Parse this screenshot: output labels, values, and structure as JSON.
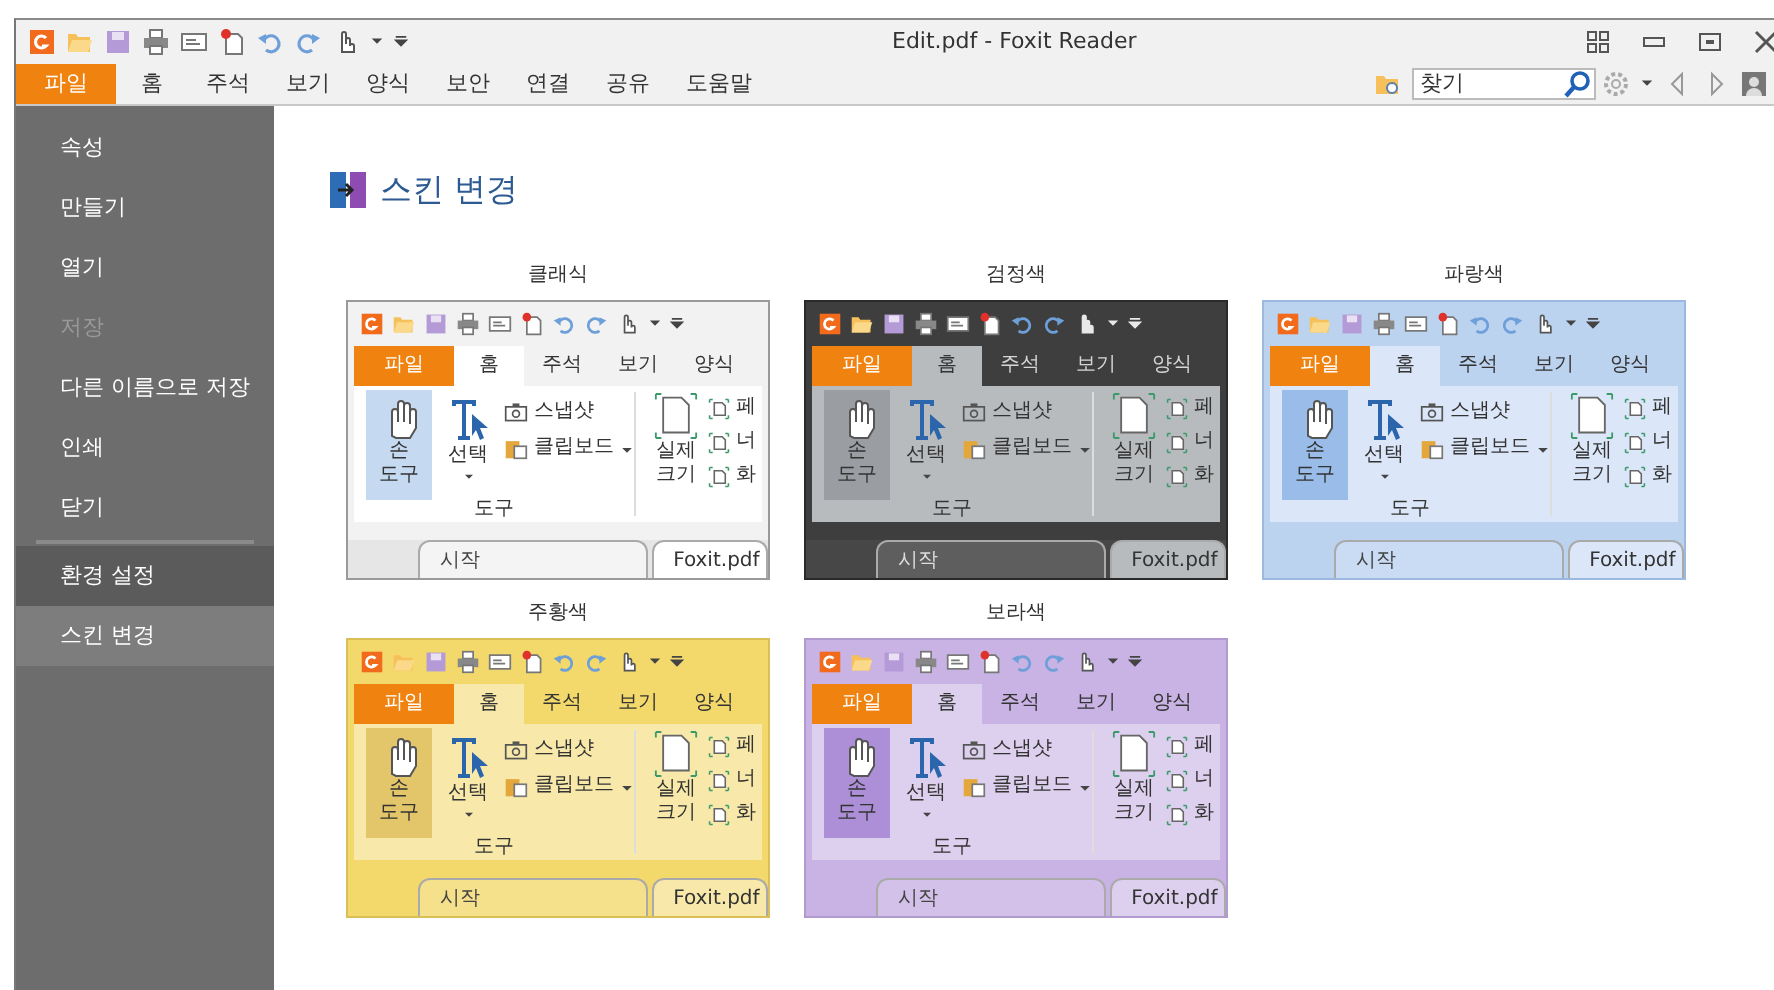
{
  "window": {
    "title": "Edit.pdf - Foxit Reader"
  },
  "menu_tabs": [
    {
      "label": "파일",
      "selected": true
    },
    {
      "label": "홈",
      "selected": false
    },
    {
      "label": "주석",
      "selected": false
    },
    {
      "label": "보기",
      "selected": false
    },
    {
      "label": "양식",
      "selected": false
    },
    {
      "label": "보안",
      "selected": false
    },
    {
      "label": "연결",
      "selected": false
    },
    {
      "label": "공유",
      "selected": false
    },
    {
      "label": "도움말",
      "selected": false
    }
  ],
  "search": {
    "placeholder": "찾기"
  },
  "sidebar": {
    "items": [
      {
        "label": "속성",
        "kind": "command",
        "disabled": false,
        "selected": false
      },
      {
        "label": "만들기",
        "kind": "command",
        "disabled": false,
        "selected": false
      },
      {
        "label": "열기",
        "kind": "command",
        "disabled": false,
        "selected": false
      },
      {
        "label": "저장",
        "kind": "command",
        "disabled": true,
        "selected": false
      },
      {
        "label": "다른 이름으로 저장",
        "kind": "command",
        "disabled": false,
        "selected": false
      },
      {
        "label": "인쇄",
        "kind": "command",
        "disabled": false,
        "selected": false
      },
      {
        "label": "닫기",
        "kind": "command",
        "disabled": false,
        "selected": false
      },
      {
        "label": "환경 설정",
        "kind": "page",
        "disabled": false,
        "selected": false
      },
      {
        "label": "스킨 변경",
        "kind": "page",
        "disabled": false,
        "selected": true
      }
    ]
  },
  "heading": "스킨 변경",
  "skins": [
    {
      "name": "클래식",
      "kind": "classic",
      "tabs": [
        {
          "label": "파일",
          "selected": false
        },
        {
          "label": "홈",
          "selected": true
        },
        {
          "label": "주석",
          "selected": false
        },
        {
          "label": "보기",
          "selected": false
        },
        {
          "label": "양식",
          "selected": false
        }
      ],
      "hand_tool": [
        "손",
        "도구"
      ],
      "hand_active": true,
      "select_tool": "선택",
      "snapshot": "스냅샷",
      "clipboard": "클립보드",
      "group_label": "도구",
      "actual_size": [
        "실제",
        "크기"
      ],
      "view_items": [
        "페",
        "너",
        "화"
      ],
      "doc_tabs": [
        {
          "label": "시작",
          "selected": false
        },
        {
          "label": "Foxit.pdf",
          "selected": true
        }
      ]
    },
    {
      "name": "검정색",
      "kind": "black",
      "tabs": [
        {
          "label": "파일",
          "selected": false
        },
        {
          "label": "홈",
          "selected": true
        },
        {
          "label": "주석",
          "selected": false
        },
        {
          "label": "보기",
          "selected": false
        },
        {
          "label": "양식",
          "selected": false
        }
      ],
      "hand_tool": [
        "손",
        "도구"
      ],
      "hand_active": true,
      "select_tool": "선택",
      "snapshot": "스냅샷",
      "clipboard": "클립보드",
      "group_label": "도구",
      "actual_size": [
        "실제",
        "크기"
      ],
      "view_items": [
        "페",
        "너",
        "화"
      ],
      "doc_tabs": [
        {
          "label": "시작",
          "selected": false
        },
        {
          "label": "Foxit.pdf",
          "selected": true
        }
      ]
    },
    {
      "name": "파랑색",
      "kind": "blue",
      "tabs": [
        {
          "label": "파일",
          "selected": false
        },
        {
          "label": "홈",
          "selected": true
        },
        {
          "label": "주석",
          "selected": false
        },
        {
          "label": "보기",
          "selected": false
        },
        {
          "label": "양식",
          "selected": false
        }
      ],
      "hand_tool": [
        "손",
        "도구"
      ],
      "hand_active": true,
      "select_tool": "선택",
      "snapshot": "스냅샷",
      "clipboard": "클립보드",
      "group_label": "도구",
      "actual_size": [
        "실제",
        "크기"
      ],
      "view_items": [
        "페",
        "너",
        "화"
      ],
      "doc_tabs": [
        {
          "label": "시작",
          "selected": false
        },
        {
          "label": "Foxit.pdf",
          "selected": true
        }
      ]
    },
    {
      "name": "주황색",
      "kind": "orange",
      "tabs": [
        {
          "label": "파일",
          "selected": false
        },
        {
          "label": "홈",
          "selected": true
        },
        {
          "label": "주석",
          "selected": false
        },
        {
          "label": "보기",
          "selected": false
        },
        {
          "label": "양식",
          "selected": false
        }
      ],
      "hand_tool": [
        "손",
        "도구"
      ],
      "hand_active": true,
      "select_tool": "선택",
      "snapshot": "스냅샷",
      "clipboard": "클립보드",
      "group_label": "도구",
      "actual_size": [
        "실제",
        "크기"
      ],
      "view_items": [
        "페",
        "너",
        "화"
      ],
      "doc_tabs": [
        {
          "label": "시작",
          "selected": false
        },
        {
          "label": "Foxit.pdf",
          "selected": true
        }
      ]
    },
    {
      "name": "보라색",
      "kind": "purple",
      "tabs": [
        {
          "label": "파일",
          "selected": false
        },
        {
          "label": "홈",
          "selected": true
        },
        {
          "label": "주석",
          "selected": false
        },
        {
          "label": "보기",
          "selected": false
        },
        {
          "label": "양식",
          "selected": false
        }
      ],
      "hand_tool": [
        "손",
        "도구"
      ],
      "hand_active": true,
      "select_tool": "선택",
      "snapshot": "스냅샷",
      "clipboard": "클립보드",
      "group_label": "도구",
      "actual_size": [
        "실제",
        "크기"
      ],
      "view_items": [
        "페",
        "너",
        "화"
      ],
      "doc_tabs": [
        {
          "label": "시작",
          "selected": false
        },
        {
          "label": "Foxit.pdf",
          "selected": true
        }
      ]
    }
  ]
}
